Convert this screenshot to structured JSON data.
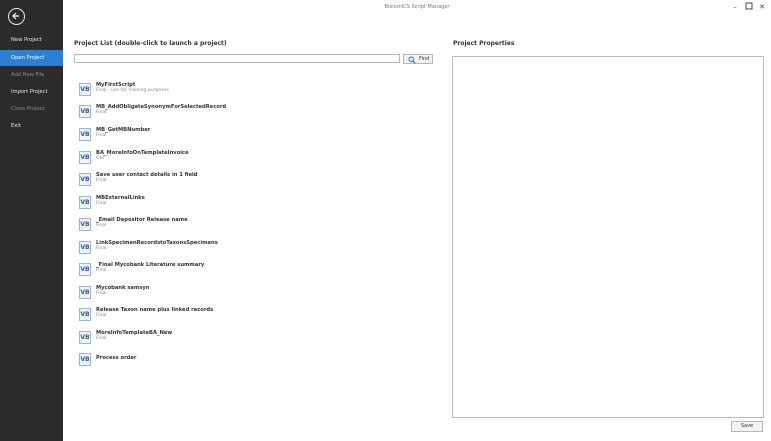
{
  "window": {
    "title": "BiolomICS Script Manager",
    "controls": [
      "minimize",
      "maximize",
      "close"
    ]
  },
  "sidebar": {
    "back_icon": "back-arrow-icon",
    "items": [
      {
        "label": "New Project",
        "state": "normal"
      },
      {
        "label": "Open Project",
        "state": "active"
      },
      {
        "label": "Add New File",
        "state": "disabled"
      },
      {
        "label": "Import Project",
        "state": "normal"
      },
      {
        "label": "Close Project",
        "state": "disabled"
      },
      {
        "label": "Exit",
        "state": "normal"
      }
    ],
    "colors": {
      "background": "#2b2b2b",
      "active": "#2d7fd4"
    }
  },
  "project_list": {
    "title": "Project List (double-click to launch a project)",
    "search": {
      "value": "",
      "placeholder": ""
    },
    "find_label": "Find",
    "projects": [
      {
        "name": "MyFirstScript",
        "status": "Final - use for training purposes",
        "icon": "VB"
      },
      {
        "name": "MB_AddObligateSynonymForSelectedRecord",
        "status": "Final",
        "icon": "VB"
      },
      {
        "name": "MB_GetMBNumber",
        "status": "Final",
        "icon": "VB"
      },
      {
        "name": "BA_MoreInfoOnTemplateInvoice",
        "status": "Old",
        "icon": "VB"
      },
      {
        "name": "Save user contact details in 1 field",
        "status": "Final",
        "icon": "VB"
      },
      {
        "name": "MBExternalLinks",
        "status": "Final",
        "icon": "VB"
      },
      {
        "name": "_Email Depositor Release name",
        "status": "Final",
        "icon": "VB"
      },
      {
        "name": "LinkSpecimenRecordstoTaxonsSpecimens",
        "status": "Final",
        "icon": "VB"
      },
      {
        "name": "_Final Mycobank Literature summary",
        "status": "Final",
        "icon": "VB"
      },
      {
        "name": "Mycobank samsyn",
        "status": "Final",
        "icon": "VB"
      },
      {
        "name": "Release Taxon name plus linked records",
        "status": "Final",
        "icon": "VB"
      },
      {
        "name": "MoreInfoTemplateBA_New",
        "status": "Final",
        "icon": "VB"
      },
      {
        "name": "Process order",
        "status": "",
        "icon": "VB"
      }
    ]
  },
  "project_properties": {
    "title": "Project Properties"
  },
  "save_label": "Save"
}
